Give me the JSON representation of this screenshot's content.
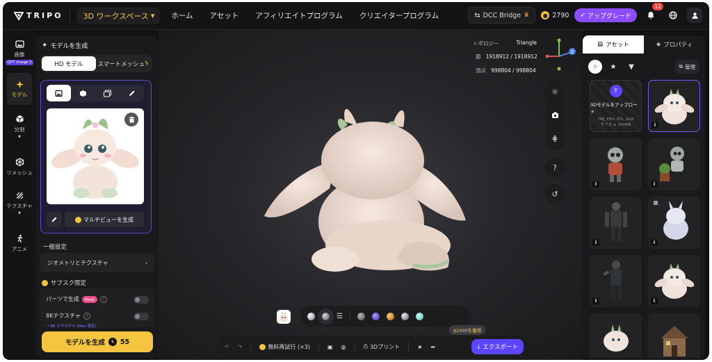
{
  "app": {
    "logo": "TRIPO",
    "workspace": "3D ワークスペース"
  },
  "nav": [
    {
      "label": "ホーム"
    },
    {
      "label": "アセット"
    },
    {
      "label": "アフィリエイトプログラム"
    },
    {
      "label": "クリエイタープログラム"
    }
  ],
  "topright": {
    "dcc": "DCC Bridge",
    "credits": "2790",
    "upgrade": "アップグレード",
    "notifications": "12"
  },
  "rail": [
    {
      "label": "画像",
      "badge": "GPT Image 2"
    },
    {
      "label": "モデル"
    },
    {
      "label": "分割"
    },
    {
      "label": "リメッシュ"
    },
    {
      "label": "テクスチャ"
    },
    {
      "label": "アニメ"
    }
  ],
  "left": {
    "title": "モデルを生成",
    "modes": [
      "HD モデル",
      "スマートメッシュ"
    ],
    "multiview": "マルチビューを生成",
    "general": "一般設定",
    "geometry": "ジオメトリとテクスチャ",
    "sub": "サブスク限定",
    "parts": "パーツで生成",
    "new": "New",
    "tex8k": "8Kテクスチャ",
    "note": "* 8K テクスチャ (Max 限定)",
    "generate": "モデルを生成",
    "cost": "55"
  },
  "viewport": {
    "topology_label": "トポロジー",
    "topology": "Triangle",
    "faces_label": "面",
    "faces": "1918912 / 1918912",
    "verts_label": "頂点",
    "verts": "998804 / 998804",
    "axis_z": "Z",
    "help": "?",
    "tip": "$2000を獲得",
    "retry": "無料再試行 (×3)",
    "print": "3Dプリント",
    "export": "エクスポート"
  },
  "right": {
    "tabs": [
      "アセット",
      "プロパティ"
    ],
    "manage": "管理",
    "upload_title": "3Dモデルをアップロード",
    "upload_formats": "OBJ, FBX, STL, GLB",
    "upload_size": "サイズ ≤ 150MB",
    "info": "i"
  },
  "colors": {
    "accent": "#5a46ff",
    "brand_yellow": "#f5c542",
    "upgrade": "#8b4dff"
  }
}
